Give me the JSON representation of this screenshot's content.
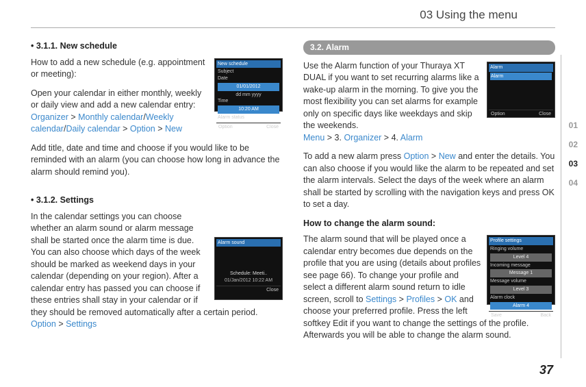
{
  "header": {
    "title": "03 Using the menu"
  },
  "left": {
    "h1": "• 3.1.1. New schedule",
    "p1a": "How to add a  new schedule (e.g. appointment or meeting):",
    "p1b": "Open your calendar in either monthly, weekly or daily view and add a new calendar entry:",
    "nav1": {
      "a": "Organizer",
      "s1": " > ",
      "b": "Monthly calendar",
      "s2": "/",
      "c": "Weekly calendar",
      "s3": "/",
      "d": "Daily calendar",
      "s4": " > ",
      "e": "Option",
      "s5": " > ",
      "f": "New"
    },
    "p1c": "Add title, date and time and choose if you would like to be reminded with an alarm (you can choose how long in advance the alarm should remind you).",
    "h2": "• 3.1.2. Settings",
    "p2": "In the calendar settings you can choose whether an alarm sound or alarm message shall be started once the alarm time is due. You can also choose which days of the week should be marked as weekend days in your calendar (depending on your region). After a calendar entry has passed you can choose if these entries shall stay in your calendar or if they should be removed automatically after a certain period.",
    "nav2": {
      "a": "Option",
      "s1": " > ",
      "b": "Settings"
    },
    "shot1": {
      "title": "New schedule",
      "r1": "Subject",
      "r2": "Date",
      "d1": "01/01/2012",
      "d2": "dd mm yyyy",
      "r3": "Time",
      "t1": "10:20 AM",
      "r4": "Alarm status",
      "fL": "Option",
      "fR": "Close"
    },
    "shot2": {
      "title": "Alarm sound",
      "d1": "Schedule: Meeti..",
      "d2": "01/Jan/2012 10:22 AM",
      "fR": "Close"
    }
  },
  "right": {
    "tab": "3.2. Alarm",
    "p1": "Use the Alarm function of your Thuraya XT DUAL if you want to set recurring alarms like a wake-up alarm in the morning. To give you the most flexibility you can set alarms for example only on specific days like weekdays and skip the weekends.",
    "nav1": {
      "a": "Menu",
      "s1": " > 3. ",
      "b": "Organizer",
      "s2": " > 4. ",
      "c": "Alarm"
    },
    "p2a": "To add a new alarm press ",
    "nav2": {
      "a": "Option",
      "s1": " > ",
      "b": "New"
    },
    "p2b": " and enter the details. You can also choose if you would like the alarm to be repeated and set the alarm intervals. Select the days of the week where an alarm shall be started by scrolling with the navigation keys and press OK to set a day.",
    "h2": "How to change the alarm sound:",
    "p3a": "The alarm sound that will be played once a calendar entry becomes due depends on the profile that you are using (details about profiles see page 66). To change your profile and select a different alarm sound return to idle screen, scroll to ",
    "nav3": {
      "a": "Settings",
      "s1": " > ",
      "b": "Profiles",
      "s2": " > ",
      "c": "OK"
    },
    "p3b": " and choose your preferred profile. Press the left softkey Edit if you want to change the settings of the profile. Afterwards you will be able to change the alarm sound.",
    "shot3": {
      "title": "Alarm",
      "r1": "Alarm",
      "fL": "Option",
      "fR": "Close"
    },
    "shot4": {
      "title": "Profile settings",
      "r1": "Ringing volume",
      "v1": "Level 4",
      "r2": "Incoming message",
      "v2": "Message 1",
      "r3": "Message volume",
      "v3": "Level 3",
      "r4": "Alarm clock",
      "v4": "Alarm 4",
      "fL": "Save",
      "fR": "Back"
    }
  },
  "tabs": {
    "t1": "01",
    "t2": "02",
    "t3": "03",
    "t4": "04"
  },
  "pagenum": "37"
}
